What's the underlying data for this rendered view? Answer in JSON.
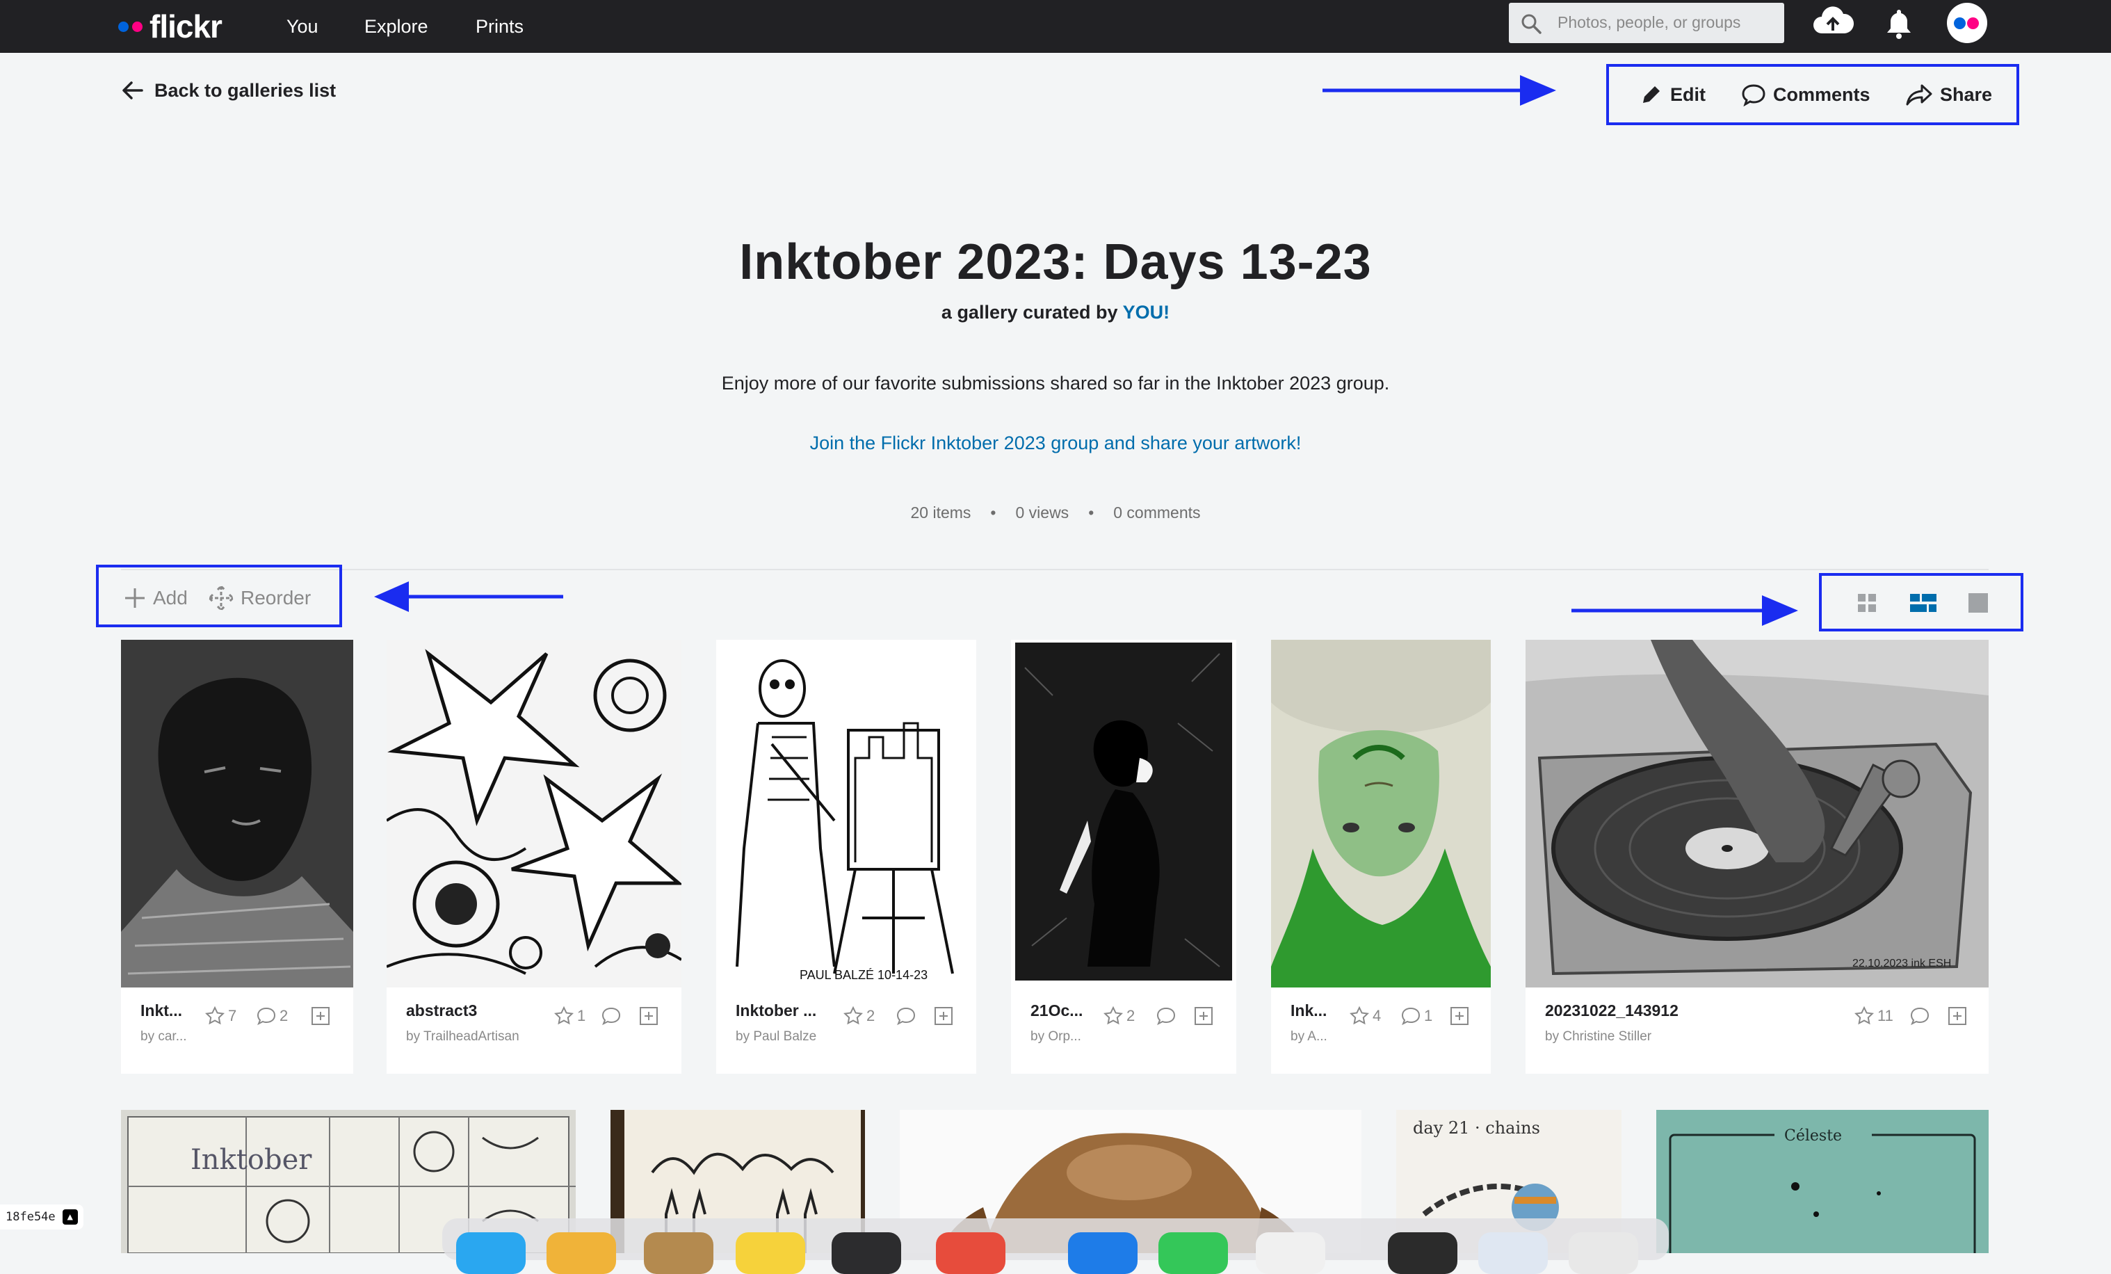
{
  "topbar": {
    "brand": "flickr",
    "nav": [
      "You",
      "Explore",
      "Prints"
    ],
    "search_placeholder": "Photos, people, or groups",
    "icons": [
      "upload-cloud-icon",
      "notification-bell-icon",
      "avatar"
    ]
  },
  "subheader": {
    "back_label": "Back to galleries list",
    "edit_label": "Edit",
    "comments_label": "Comments",
    "share_label": "Share"
  },
  "gallery": {
    "title": "Inktober 2023: Days 13-23",
    "curated_prefix": "a gallery curated by ",
    "curated_by": "YOU!",
    "description": "Enjoy more of our favorite submissions shared so far in the Inktober 2023 group.",
    "join_link": "Join the Flickr Inktober 2023 group and share your artwork!",
    "stats": {
      "items": "20 items",
      "views": "0 views",
      "comments": "0 comments",
      "separator": "•"
    }
  },
  "toolbar": {
    "add_label": "Add",
    "reorder_label": "Reorder",
    "view_modes": [
      "grid-view",
      "justified-view",
      "single-view"
    ],
    "selected_view": "justified-view"
  },
  "photos": [
    {
      "title": "Inkt...",
      "author": "by car...",
      "faves": "7",
      "comments": "2"
    },
    {
      "title": "abstract3",
      "author": "by TrailheadArtisan",
      "faves": "1",
      "comments": ""
    },
    {
      "title": "Inktober ...",
      "author": "by Paul Balze",
      "faves": "2",
      "comments": ""
    },
    {
      "title": "21Oc...",
      "author": "by Orp...",
      "faves": "2",
      "comments": ""
    },
    {
      "title": "Ink...",
      "author": "by A...",
      "faves": "4",
      "comments": "1"
    },
    {
      "title": "20231022_143912",
      "author": "by Christine Stiller",
      "faves": "11",
      "comments": ""
    }
  ],
  "second_row_texts": {
    "day21": "day 21 · chains",
    "celeste": "Céleste"
  },
  "artwork_text": {
    "signature_paul": "PAUL BALZÉ 10-14-23",
    "signature_turntable": "22.10.2023 ink ESH",
    "inktober_sheet": "Inktober"
  },
  "badge": {
    "hash": "18fe54e"
  },
  "colors": {
    "topbar": "#212124",
    "link": "#006dac",
    "annotation": "#1a2cf0",
    "selected_view": "#006dac",
    "bg": "#f3f5f6"
  }
}
